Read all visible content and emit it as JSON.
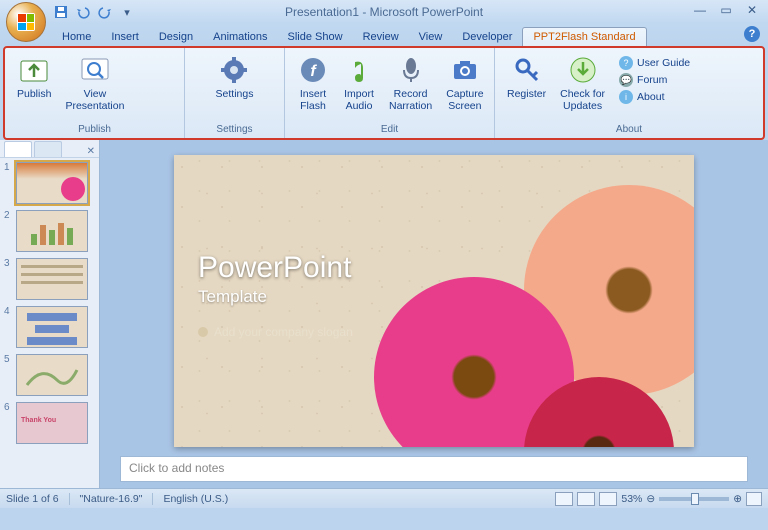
{
  "title": "Presentation1 - Microsoft PowerPoint",
  "tabs": [
    "Home",
    "Insert",
    "Design",
    "Animations",
    "Slide Show",
    "Review",
    "View",
    "Developer",
    "PPT2Flash Standard"
  ],
  "active_tab": 8,
  "ribbon": {
    "groups": [
      {
        "label": "Publish",
        "buttons": [
          {
            "label": "Publish",
            "icon": "publish"
          },
          {
            "label": "View\nPresentation",
            "icon": "magnify"
          }
        ]
      },
      {
        "label": "Settings",
        "buttons": [
          {
            "label": "Settings",
            "icon": "gear"
          }
        ]
      },
      {
        "label": "Edit",
        "buttons": [
          {
            "label": "Insert\nFlash",
            "icon": "flash"
          },
          {
            "label": "Import\nAudio",
            "icon": "audio"
          },
          {
            "label": "Record\nNarration",
            "icon": "mic"
          },
          {
            "label": "Capture\nScreen",
            "icon": "camera"
          }
        ]
      },
      {
        "label": "About",
        "buttons": [
          {
            "label": "Register",
            "icon": "key"
          },
          {
            "label": "Check for\nUpdates",
            "icon": "update"
          }
        ],
        "links": [
          "User Guide",
          "Forum",
          "About"
        ]
      }
    ]
  },
  "thumbnails": [
    1,
    2,
    3,
    4,
    5,
    6
  ],
  "selected_thumb": 1,
  "slide": {
    "title": "PowerPoint",
    "subtitle": "Template",
    "slogan": "Add your company slogan"
  },
  "notes_placeholder": "Click to add notes",
  "status": {
    "slide": "Slide 1 of 6",
    "theme": "\"Nature-16.9\"",
    "lang": "English (U.S.)",
    "zoom": "53%"
  }
}
